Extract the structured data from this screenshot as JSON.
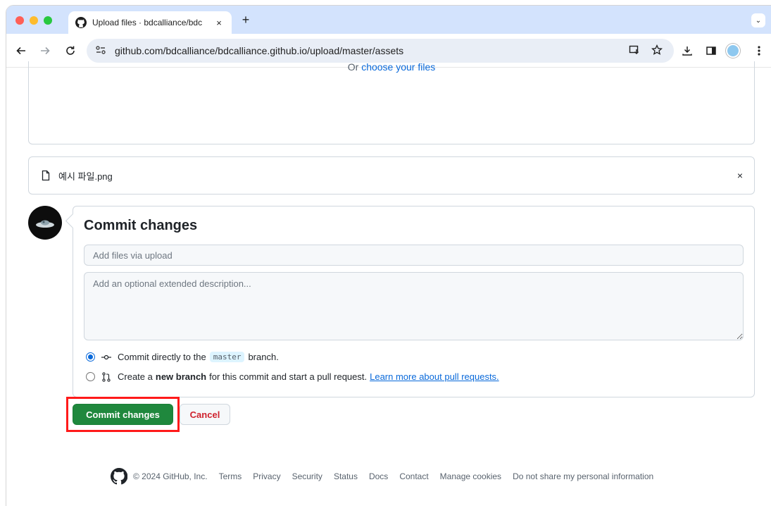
{
  "browser": {
    "tab_title": "Upload files · bdcalliance/bdc",
    "tab_close": "×",
    "new_tab": "+",
    "tab_search": "⌄",
    "url": "github.com/bdcalliance/bdcalliance.github.io/upload/master/assets",
    "icons": [
      "back-icon",
      "forward-icon",
      "reload-icon",
      "site-info-icon",
      "install-app-icon",
      "star-icon",
      "download-icon",
      "side-panel-icon",
      "profile-avatar",
      "menu-icon"
    ]
  },
  "upload": {
    "choose_prefix": "Or ",
    "choose_link": "choose your files",
    "file_name": "예시 파일.png",
    "remove": "×"
  },
  "commit": {
    "title": "Commit changes",
    "summary_placeholder": "Add files via upload",
    "description_placeholder": "Add an optional extended description...",
    "option_direct_prefix": "Commit directly to the",
    "branch_name": "master",
    "option_direct_suffix": "branch.",
    "option_new_prefix": "Create a",
    "option_new_bold": "new branch",
    "option_new_suffix": "for this commit and start a pull request.",
    "learn_more": "Learn more about pull requests.",
    "commit_button": "Commit changes",
    "cancel_button": "Cancel"
  },
  "footer": {
    "copyright": "© 2024 GitHub, Inc.",
    "links": [
      "Terms",
      "Privacy",
      "Security",
      "Status",
      "Docs",
      "Contact",
      "Manage cookies",
      "Do not share my personal information"
    ]
  },
  "colors": {
    "commit_green": "#1f883d",
    "link_blue": "#0969da",
    "cancel_red": "#cf222e",
    "highlight_red": "#ff1a1a",
    "tab_strip": "#d3e3fd"
  }
}
